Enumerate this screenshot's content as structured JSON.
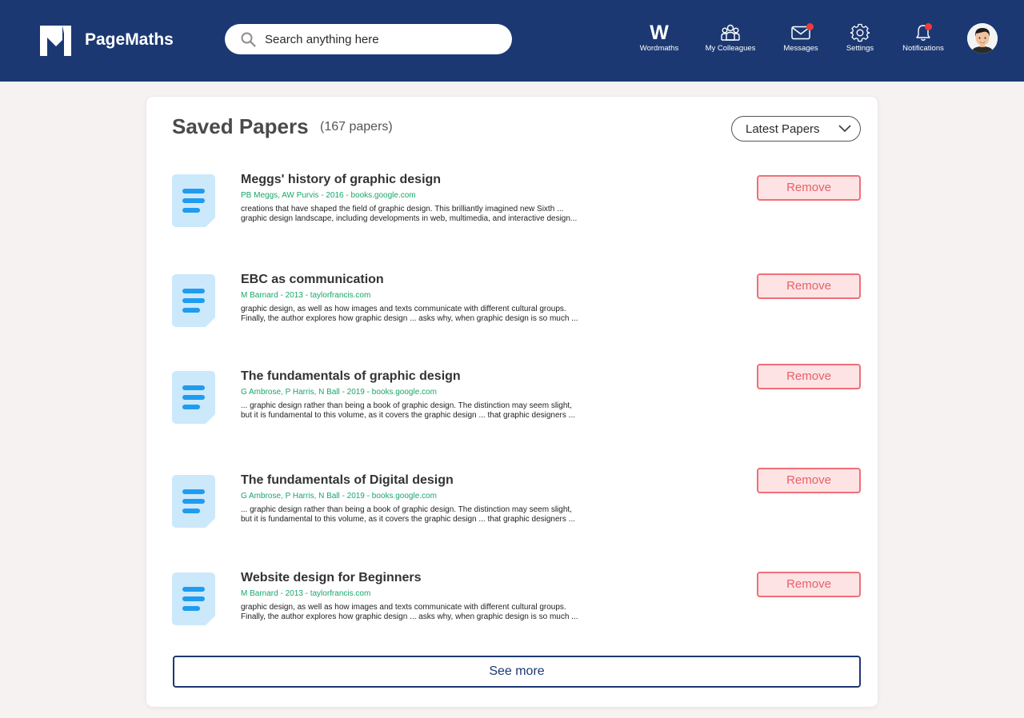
{
  "brand": {
    "name": "PageMaths"
  },
  "search": {
    "placeholder": "Search anything here"
  },
  "nav": {
    "wordmaths_glyph": "W",
    "items": [
      {
        "label": "Wordmaths",
        "icon": "wordmaths-icon",
        "badge": false
      },
      {
        "label": "My Colleagues",
        "icon": "colleagues-icon",
        "badge": false
      },
      {
        "label": "Messages",
        "icon": "mail-icon",
        "badge": true
      },
      {
        "label": "Settings",
        "icon": "gear-icon",
        "badge": false
      },
      {
        "label": "Notifications",
        "icon": "bell-icon",
        "badge": true
      }
    ]
  },
  "page": {
    "title": "Saved Papers",
    "count": "(167 papers)",
    "sort_selected": "Latest Papers"
  },
  "papers": [
    {
      "title": "Meggs' history of graphic design",
      "meta": "PB Meggs, AW Purvis - 2016 - books.google.com",
      "snippet1": "creations that have shaped the field of graphic design. This brilliantly imagined new Sixth ...",
      "snippet2": "graphic design landscape, including developments in web, multimedia, and interactive design...",
      "remove": "Remove"
    },
    {
      "title": "EBC as communication",
      "meta": "M Barnard - 2013 - taylorfrancis.com",
      "snippet1": "graphic design, as well as how images and texts communicate with different cultural groups.",
      "snippet2": "Finally, the author explores how graphic design ... asks why, when graphic design is so much ...",
      "remove": "Remove"
    },
    {
      "title": "The fundamentals of graphic design",
      "meta": "G Ambrose, P Harris, N Ball - 2019 - books.google.com",
      "snippet1": "... graphic design rather than being a book of graphic design. The distinction may seem slight,",
      "snippet2": "but it is fundamental to this volume, as it covers the graphic design ... that graphic designers ...",
      "remove": "Remove"
    },
    {
      "title": "The fundamentals of Digital design",
      "meta": "G Ambrose, P Harris, N Ball - 2019 - books.google.com",
      "snippet1": "... graphic design rather than being a book of graphic design. The distinction may seem slight,",
      "snippet2": "but it is fundamental to this volume, as it covers the graphic design ... that graphic designers ...",
      "remove": "Remove"
    },
    {
      "title": "Website design for Beginners",
      "meta": "M Barnard - 2013 - taylorfrancis.com",
      "snippet1": "graphic design, as well as how images and texts communicate with different cultural groups.",
      "snippet2": "Finally, the author explores how graphic design ... asks why, when graphic design is so much ...",
      "remove": "Remove"
    }
  ],
  "see_more": "See more",
  "colors": {
    "header_bg": "#1b3872",
    "accent_green": "#1aa66b",
    "remove_border": "#ef6f78",
    "remove_bg": "#fde3e3",
    "badge_red": "#ef3b3b",
    "doc_icon_bg": "#cce8fb",
    "doc_icon_lines": "#1f9cf0"
  }
}
